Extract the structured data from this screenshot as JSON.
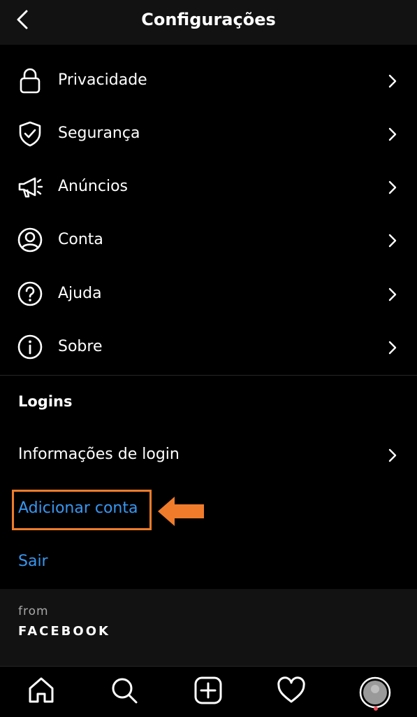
{
  "header": {
    "title": "Configurações",
    "back_icon": "chevron-left-icon"
  },
  "settings": [
    {
      "label": "Privacidade",
      "icon": "lock-icon"
    },
    {
      "label": "Segurança",
      "icon": "shield-check-icon"
    },
    {
      "label": "Anúncios",
      "icon": "megaphone-icon"
    },
    {
      "label": "Conta",
      "icon": "user-circle-icon"
    },
    {
      "label": "Ajuda",
      "icon": "help-circle-icon"
    },
    {
      "label": "Sobre",
      "icon": "info-circle-icon"
    }
  ],
  "logins": {
    "title": "Logins",
    "login_info": "Informações de login",
    "add_account": "Adicionar conta",
    "logout": "Sair"
  },
  "footer": {
    "from": "from",
    "brand": "FACEBOOK"
  },
  "tabbar": [
    "home-icon",
    "search-icon",
    "new-post-icon",
    "heart-icon",
    "profile-avatar"
  ],
  "colors": {
    "background": "#000000",
    "link": "#3897f0",
    "highlight": "#f07c2b",
    "panel": "#121212"
  }
}
